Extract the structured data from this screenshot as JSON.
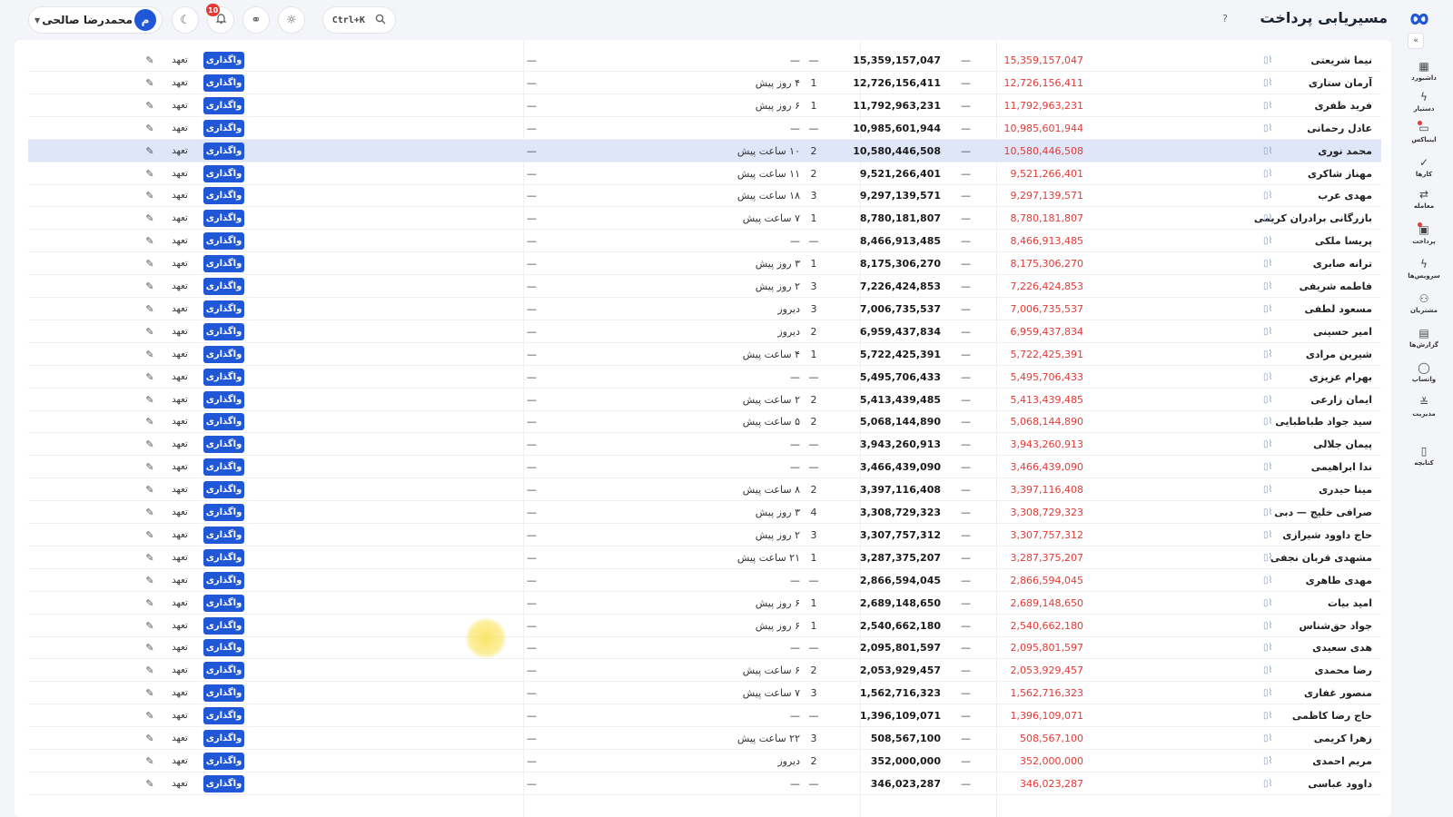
{
  "header": {
    "title": "مسیریابی پرداخت",
    "help_icon": "?",
    "user": {
      "name": "محمدرضا صالحی",
      "avatar_letter": "م"
    },
    "notifications_count": "10",
    "search_shortcut": "Ctrl+K",
    "icons": [
      "moon-icon",
      "bell-icon",
      "link-icon",
      "bug-icon",
      "search-icon"
    ]
  },
  "sidebar": {
    "collapse": "«",
    "items": [
      {
        "label": "داشبورد",
        "icon": "dashboard-icon"
      },
      {
        "label": "دستیار",
        "icon": "bolt-icon"
      },
      {
        "label": "اینباکس",
        "icon": "inbox-icon",
        "dot": true
      },
      {
        "label": "کارها",
        "icon": "check-icon"
      },
      {
        "label": "معامله",
        "icon": "exchange-icon"
      },
      {
        "label": "پرداخت",
        "icon": "payment-icon",
        "dot": true
      },
      {
        "label": "سرویس‌ها",
        "icon": "services-icon"
      },
      {
        "label": "مشتریان",
        "icon": "customers-icon"
      },
      {
        "label": "گزارش‌ها",
        "icon": "reports-icon"
      },
      {
        "label": "واتساپ",
        "icon": "chat-icon"
      },
      {
        "label": "مدیریت",
        "icon": "settings-icon"
      },
      {
        "label": "کتابچه",
        "icon": "book-icon"
      }
    ]
  },
  "actions": {
    "assign_label": "واگذاری",
    "pledge_label": "تعهد",
    "edit_glyph": "✎",
    "dash": "—"
  },
  "rows": [
    {
      "name": "نیما شریعتی",
      "red": "15,359,157,047",
      "bold": "15,359,157,047",
      "count": "—",
      "last": "—"
    },
    {
      "name": "آرمان ستاری",
      "red": "12,726,156,411",
      "bold": "12,726,156,411",
      "count": "1",
      "last": "۴ روز پیش"
    },
    {
      "name": "فرید ظفری",
      "red": "11,792,963,231",
      "bold": "11,792,963,231",
      "count": "1",
      "last": "۶ روز پیش"
    },
    {
      "name": "عادل رحمانی",
      "red": "10,985,601,944",
      "bold": "10,985,601,944",
      "count": "—",
      "last": "—"
    },
    {
      "name": "محمد نوری",
      "red": "10,580,446,508",
      "bold": "10,580,446,508",
      "count": "2",
      "last": "۱۰ ساعت پیش",
      "selected": true
    },
    {
      "name": "مهناز شاکری",
      "red": "9,521,266,401",
      "bold": "9,521,266,401",
      "count": "2",
      "last": "۱۱ ساعت پیش"
    },
    {
      "name": "مهدی عرب",
      "red": "9,297,139,571",
      "bold": "9,297,139,571",
      "count": "3",
      "last": "۱۸ ساعت پیش"
    },
    {
      "name": "بازرگانی برادران کریمی",
      "red": "8,780,181,807",
      "bold": "8,780,181,807",
      "count": "1",
      "last": "۷ ساعت پیش"
    },
    {
      "name": "پریسا ملکی",
      "red": "8,466,913,485",
      "bold": "8,466,913,485",
      "count": "—",
      "last": "—"
    },
    {
      "name": "ترانه صابری",
      "red": "8,175,306,270",
      "bold": "8,175,306,270",
      "count": "1",
      "last": "۳ روز پیش"
    },
    {
      "name": "فاطمه شریفی",
      "red": "7,226,424,853",
      "bold": "7,226,424,853",
      "count": "3",
      "last": "۲ روز پیش"
    },
    {
      "name": "مسعود لطفی",
      "red": "7,006,735,537",
      "bold": "7,006,735,537",
      "count": "3",
      "last": "دیروز"
    },
    {
      "name": "امیر حسینی",
      "red": "6,959,437,834",
      "bold": "6,959,437,834",
      "count": "2",
      "last": "دیروز"
    },
    {
      "name": "شیرین مرادی",
      "red": "5,722,425,391",
      "bold": "5,722,425,391",
      "count": "1",
      "last": "۴ ساعت پیش"
    },
    {
      "name": "بهرام عزیزی",
      "red": "5,495,706,433",
      "bold": "5,495,706,433",
      "count": "—",
      "last": "—"
    },
    {
      "name": "ایمان زارعی",
      "red": "5,413,439,485",
      "bold": "5,413,439,485",
      "count": "2",
      "last": "۲ ساعت پیش"
    },
    {
      "name": "سید جواد طباطبایی",
      "red": "5,068,144,890",
      "bold": "5,068,144,890",
      "count": "2",
      "last": "۵ ساعت پیش"
    },
    {
      "name": "پیمان جلالی",
      "red": "3,943,260,913",
      "bold": "3,943,260,913",
      "count": "—",
      "last": "—"
    },
    {
      "name": "ندا ابراهیمی",
      "red": "3,466,439,090",
      "bold": "3,466,439,090",
      "count": "—",
      "last": "—"
    },
    {
      "name": "مینا حیدری",
      "red": "3,397,116,408",
      "bold": "3,397,116,408",
      "count": "2",
      "last": "۸ ساعت پیش"
    },
    {
      "name": "صرافی خلیج — دبی",
      "red": "3,308,729,323",
      "bold": "3,308,729,323",
      "count": "4",
      "last": "۳ روز پیش"
    },
    {
      "name": "حاج داوود شیرازی",
      "red": "3,307,757,312",
      "bold": "3,307,757,312",
      "count": "3",
      "last": "۲ روز پیش"
    },
    {
      "name": "مشهدی قربان نجفی",
      "red": "3,287,375,207",
      "bold": "3,287,375,207",
      "count": "1",
      "last": "۲۱ ساعت پیش"
    },
    {
      "name": "مهدی طاهری",
      "red": "2,866,594,045",
      "bold": "2,866,594,045",
      "count": "—",
      "last": "—"
    },
    {
      "name": "امید بیات",
      "red": "2,689,148,650",
      "bold": "2,689,148,650",
      "count": "1",
      "last": "۶ روز پیش"
    },
    {
      "name": "جواد حق‌شناس",
      "red": "2,540,662,180",
      "bold": "2,540,662,180",
      "count": "1",
      "last": "۶ روز پیش"
    },
    {
      "name": "هدی سعیدی",
      "red": "2,095,801,597",
      "bold": "2,095,801,597",
      "count": "—",
      "last": "—"
    },
    {
      "name": "رضا محمدی",
      "red": "2,053,929,457",
      "bold": "2,053,929,457",
      "count": "2",
      "last": "۶ ساعت پیش"
    },
    {
      "name": "منصور غفاری",
      "red": "1,562,716,323",
      "bold": "1,562,716,323",
      "count": "3",
      "last": "۷ ساعت پیش"
    },
    {
      "name": "حاج رضا کاظمی",
      "red": "1,396,109,071",
      "bold": "1,396,109,071",
      "count": "—",
      "last": "—"
    },
    {
      "name": "زهرا کریمی",
      "red": "508,567,100",
      "bold": "508,567,100",
      "count": "3",
      "last": "۲۲ ساعت پیش"
    },
    {
      "name": "مریم احمدی",
      "red": "352,000,000",
      "bold": "352,000,000",
      "count": "2",
      "last": "دیروز"
    },
    {
      "name": "داوود عباسی",
      "red": "346,023,287",
      "bold": "346,023,287",
      "count": "—",
      "last": "—"
    }
  ]
}
